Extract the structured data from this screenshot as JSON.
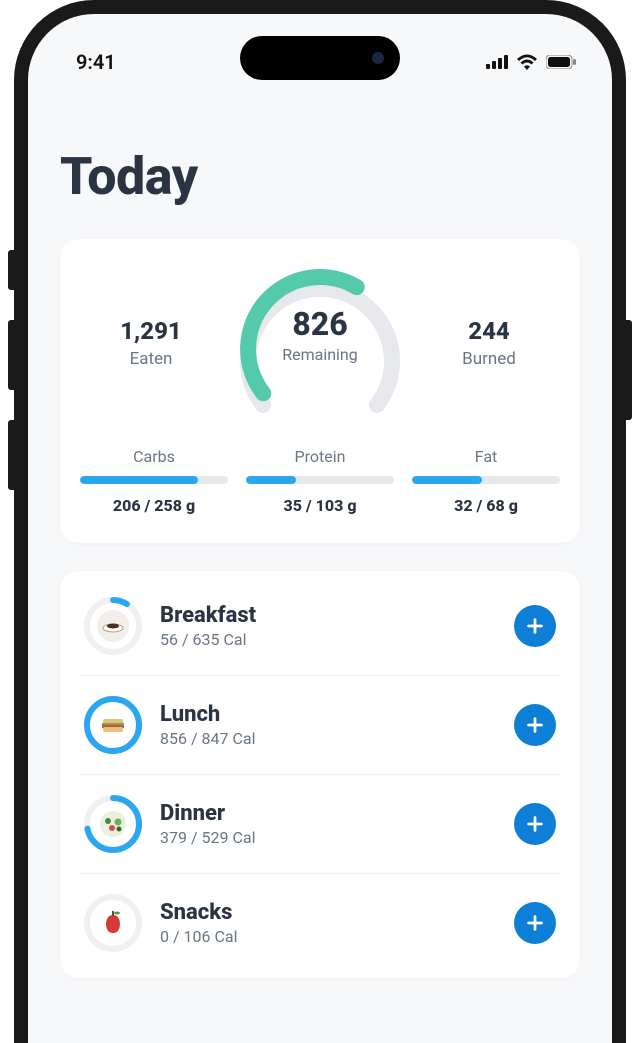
{
  "status": {
    "time": "9:41"
  },
  "header": {
    "title": "Today"
  },
  "summary": {
    "eaten": {
      "value": "1,291",
      "label": "Eaten"
    },
    "remaining": {
      "value": "826",
      "label": "Remaining",
      "progress": 0.62
    },
    "burned": {
      "value": "244",
      "label": "Burned"
    }
  },
  "macros": [
    {
      "name": "Carbs",
      "consumed": 206,
      "goal": 258,
      "unit": "g",
      "display": "206 / 258 g"
    },
    {
      "name": "Protein",
      "consumed": 35,
      "goal": 103,
      "unit": "g",
      "display": "35 / 103 g"
    },
    {
      "name": "Fat",
      "consumed": 32,
      "goal": 68,
      "unit": "g",
      "display": "32 / 68 g"
    }
  ],
  "meals": [
    {
      "name": "Breakfast",
      "consumed": 56,
      "goal": 635,
      "display": "56 / 635 Cal",
      "icon": "coffee",
      "progress": 0.09
    },
    {
      "name": "Lunch",
      "consumed": 856,
      "goal": 847,
      "display": "856 / 847 Cal",
      "icon": "sandwich",
      "progress": 1.0
    },
    {
      "name": "Dinner",
      "consumed": 379,
      "goal": 529,
      "display": "379 / 529 Cal",
      "icon": "salad",
      "progress": 0.72
    },
    {
      "name": "Snacks",
      "consumed": 0,
      "goal": 106,
      "display": "0 / 106 Cal",
      "icon": "apple",
      "progress": 0.0
    }
  ],
  "colors": {
    "accent": "#2aa8ef",
    "gauge": "#55c9ac",
    "addBtn": "#0d7fd6"
  }
}
